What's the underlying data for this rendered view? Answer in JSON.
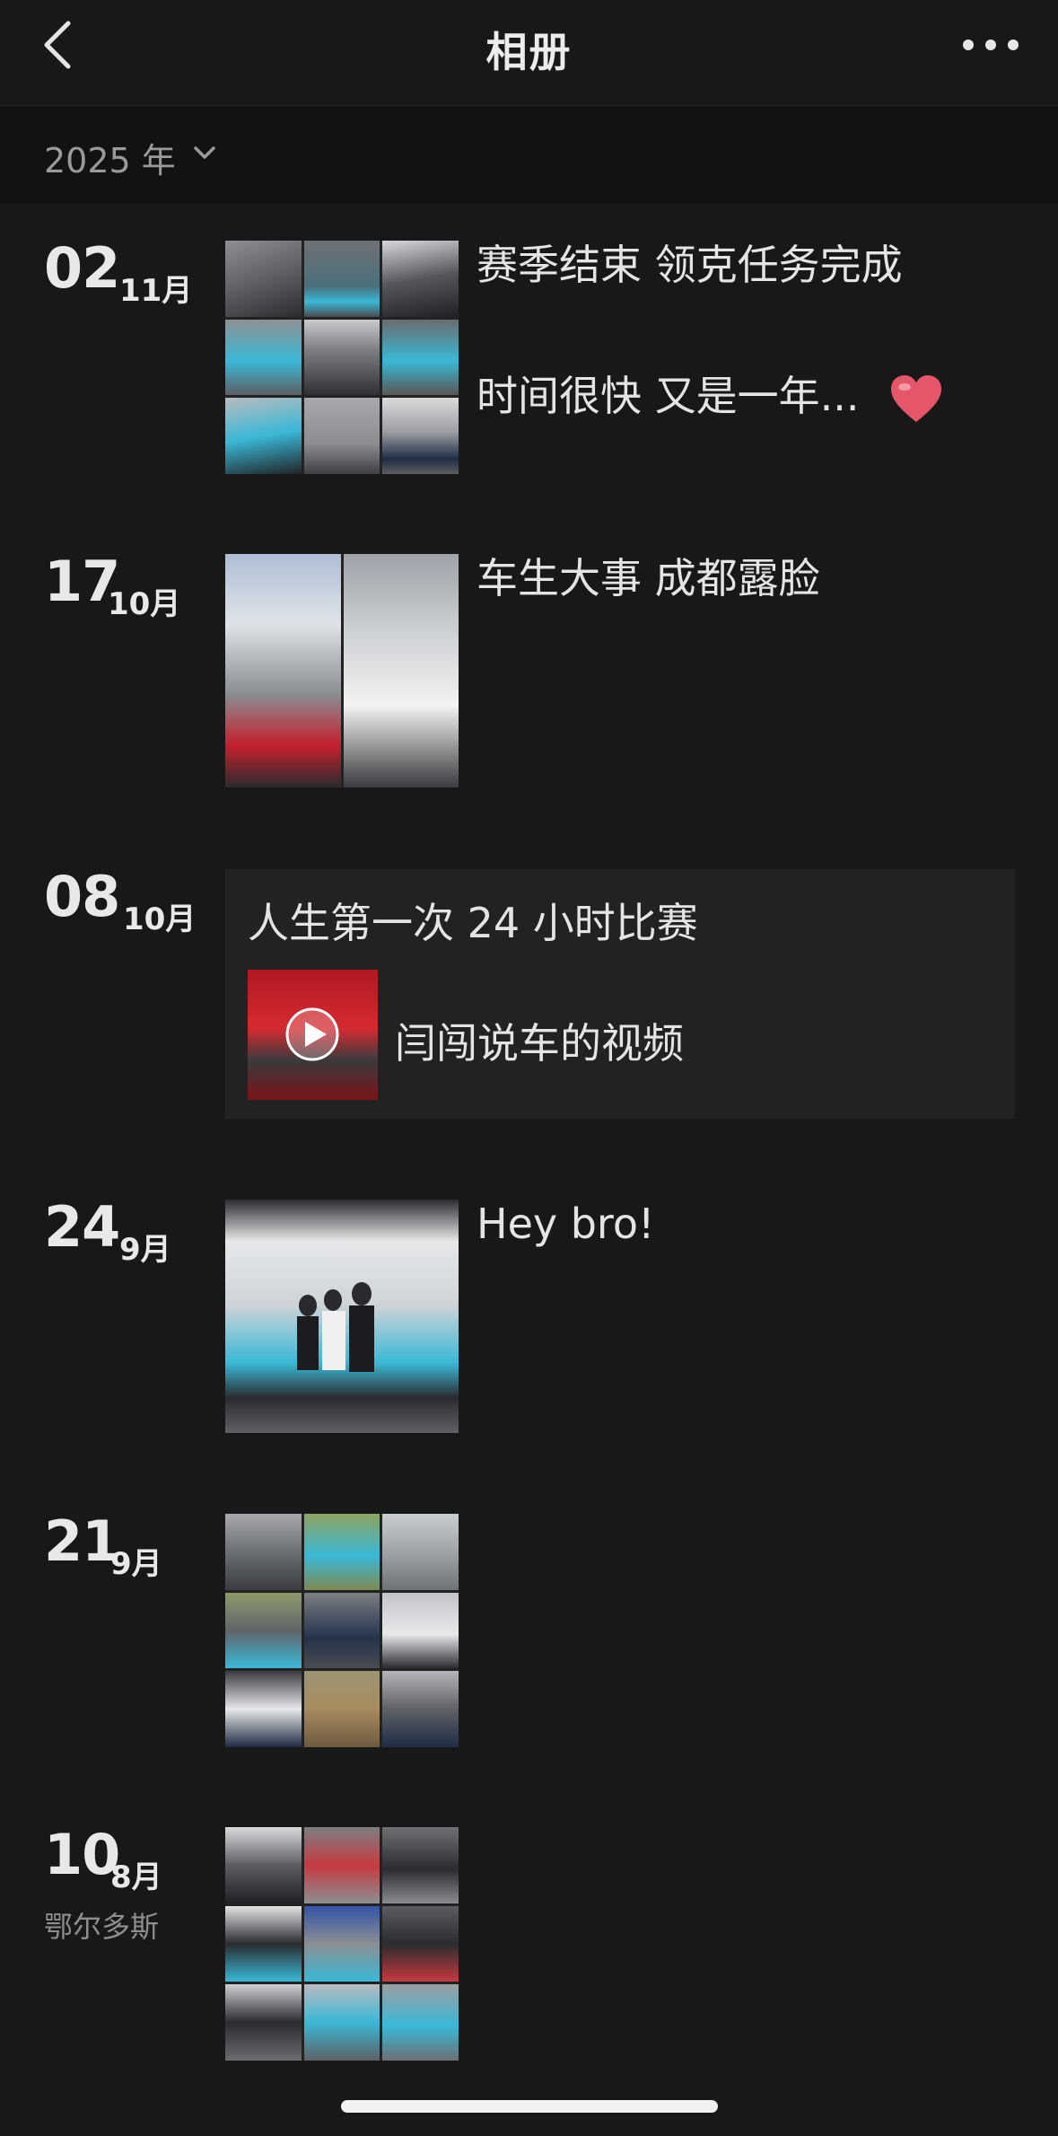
{
  "header": {
    "title": "相册",
    "back_icon": "chevron-left-icon",
    "more_icon": "more-horizontal-icon"
  },
  "year_selector": {
    "label": "2025 年",
    "icon": "chevron-down-icon"
  },
  "entries": [
    {
      "day": "02",
      "month": "11月",
      "caption_lines": [
        "赛季结束 领克任务完成",
        "时间很快 又是一年..."
      ],
      "emoji": "heart-icon"
    },
    {
      "day": "17",
      "month": "10月",
      "caption": "车生大事 成都露脸"
    },
    {
      "day": "08",
      "month": "10月",
      "share_title": "人生第一次 24 小时比赛",
      "share_label": "闫闯说车的视频",
      "share_icon": "play-icon"
    },
    {
      "day": "24",
      "month": "9月",
      "caption": "Hey bro!"
    },
    {
      "day": "21",
      "month": "9月"
    },
    {
      "day": "10",
      "month": "8月",
      "location": "鄂尔多斯"
    }
  ],
  "colors": {
    "background": "#181818",
    "yearbar": "#121212",
    "text": "#e6e6e6",
    "muted": "#9a9a9a",
    "card": "#222222",
    "accent_cyan": "#3ab8d6",
    "heart": "#e5566b"
  }
}
